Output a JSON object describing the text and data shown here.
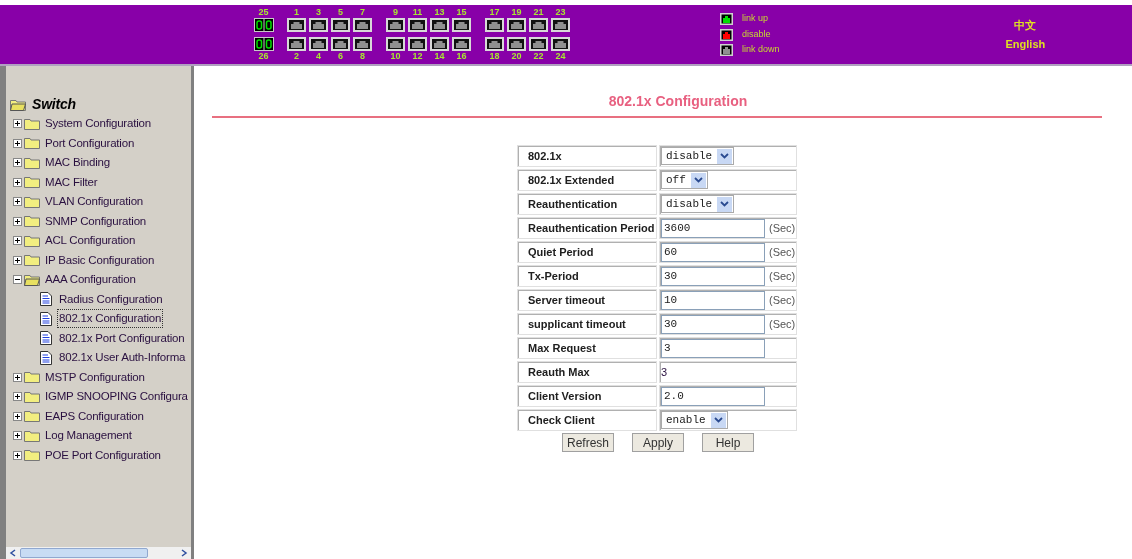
{
  "header": {
    "port_groups": [
      {
        "ports": [
          {
            "top": {
              "label": "25",
              "link_up": true
            },
            "bottom": {
              "label": "26",
              "link_up": true
            },
            "kind": "fiber"
          }
        ]
      },
      {
        "ports": [
          {
            "top": {
              "label": "1",
              "link_up": false
            },
            "bottom": {
              "label": "2",
              "link_up": false
            },
            "kind": "copper"
          },
          {
            "top": {
              "label": "3",
              "link_up": false
            },
            "bottom": {
              "label": "4",
              "link_up": false
            },
            "kind": "copper"
          },
          {
            "top": {
              "label": "5",
              "link_up": false
            },
            "bottom": {
              "label": "6",
              "link_up": false
            },
            "kind": "copper"
          },
          {
            "top": {
              "label": "7",
              "link_up": false
            },
            "bottom": {
              "label": "8",
              "link_up": false
            },
            "kind": "copper"
          }
        ]
      },
      {
        "ports": [
          {
            "top": {
              "label": "9",
              "link_up": false
            },
            "bottom": {
              "label": "10",
              "link_up": false
            },
            "kind": "copper"
          },
          {
            "top": {
              "label": "11",
              "link_up": false
            },
            "bottom": {
              "label": "12",
              "link_up": false
            },
            "kind": "copper"
          },
          {
            "top": {
              "label": "13",
              "link_up": false
            },
            "bottom": {
              "label": "14",
              "link_up": false
            },
            "kind": "copper"
          },
          {
            "top": {
              "label": "15",
              "link_up": false
            },
            "bottom": {
              "label": "16",
              "link_up": false
            },
            "kind": "copper"
          }
        ]
      },
      {
        "ports": [
          {
            "top": {
              "label": "17",
              "link_up": false
            },
            "bottom": {
              "label": "18",
              "link_up": false
            },
            "kind": "copper"
          },
          {
            "top": {
              "label": "19",
              "link_up": false
            },
            "bottom": {
              "label": "20",
              "link_up": false
            },
            "kind": "copper"
          },
          {
            "top": {
              "label": "21",
              "link_up": false
            },
            "bottom": {
              "label": "22",
              "link_up": false
            },
            "kind": "copper"
          },
          {
            "top": {
              "label": "23",
              "link_up": false
            },
            "bottom": {
              "label": "24",
              "link_up": false
            },
            "kind": "copper"
          }
        ]
      }
    ],
    "legend": [
      {
        "label": "link up",
        "color": "#00e000"
      },
      {
        "label": "disable",
        "color": "#ff0000"
      },
      {
        "label": "link down",
        "color": "#909090"
      }
    ],
    "languages": [
      {
        "label": "中文"
      },
      {
        "label": "English"
      }
    ]
  },
  "sidebar": {
    "root": "Switch",
    "items": [
      {
        "label": "System Configuration",
        "expanded": false
      },
      {
        "label": "Port Configuration",
        "expanded": false
      },
      {
        "label": "MAC Binding",
        "expanded": false
      },
      {
        "label": "MAC Filter",
        "expanded": false
      },
      {
        "label": "VLAN Configuration",
        "expanded": false
      },
      {
        "label": "SNMP Configuration",
        "expanded": false
      },
      {
        "label": "ACL Configuration",
        "expanded": false
      },
      {
        "label": "IP Basic Configuration",
        "expanded": false
      },
      {
        "label": "AAA Configuration",
        "expanded": true,
        "children": [
          {
            "label": "Radius Configuration",
            "selected": false
          },
          {
            "label": "802.1x Configuration",
            "selected": true
          },
          {
            "label": "802.1x Port Configuration",
            "selected": false
          },
          {
            "label": "802.1x User Auth-Informa",
            "selected": false
          }
        ]
      },
      {
        "label": "MSTP Configuration",
        "expanded": false
      },
      {
        "label": "IGMP SNOOPING Configura",
        "expanded": false
      },
      {
        "label": "EAPS Configuration",
        "expanded": false
      },
      {
        "label": "Log Management",
        "expanded": false
      },
      {
        "label": "POE Port Configuration",
        "expanded": false
      }
    ]
  },
  "main": {
    "title": "802.1x Configuration",
    "fields": [
      {
        "label": "802.1x",
        "kind": "select",
        "value": "disable"
      },
      {
        "label": "802.1x Extended",
        "kind": "select",
        "value": "off"
      },
      {
        "label": "Reauthentication",
        "kind": "select",
        "value": "disable"
      },
      {
        "label": "Reauthentication Period",
        "kind": "input",
        "value": "3600",
        "unit": "(Sec)"
      },
      {
        "label": "Quiet Period",
        "kind": "input",
        "value": "60",
        "unit": "(Sec)"
      },
      {
        "label": "Tx-Period",
        "kind": "input",
        "value": "30",
        "unit": "(Sec)"
      },
      {
        "label": "Server timeout",
        "kind": "input",
        "value": "10",
        "unit": "(Sec)"
      },
      {
        "label": "supplicant timeout",
        "kind": "input",
        "value": "30",
        "unit": "(Sec)"
      },
      {
        "label": "Max Request",
        "kind": "input",
        "value": "3"
      },
      {
        "label": "Reauth Max",
        "kind": "text",
        "value": "3"
      },
      {
        "label": "Client Version",
        "kind": "input",
        "value": "2.0"
      },
      {
        "label": "Check Client",
        "kind": "select",
        "value": "enable"
      }
    ],
    "buttons": [
      {
        "label": "Refresh"
      },
      {
        "label": "Apply"
      },
      {
        "label": "Help"
      }
    ]
  }
}
